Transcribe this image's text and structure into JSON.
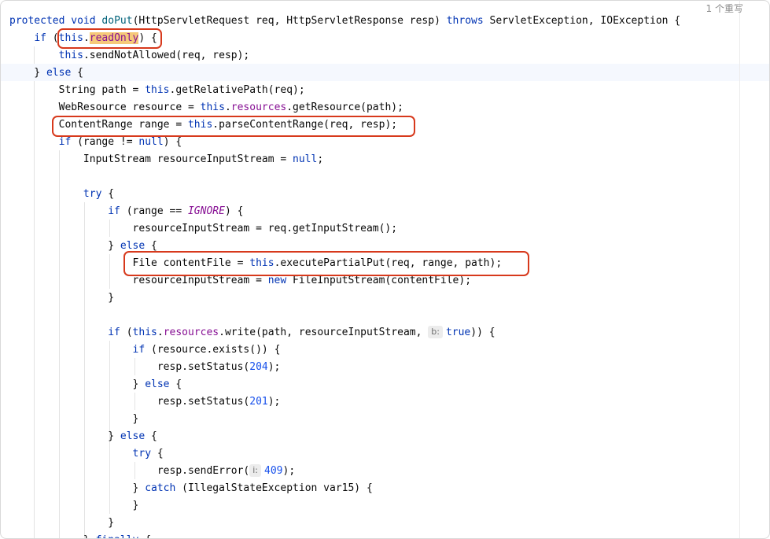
{
  "editor": {
    "inlay_hint": "1 个重写",
    "lines": [
      [
        [
          "kw",
          "protected"
        ],
        [
          "plain",
          " "
        ],
        [
          "kw",
          "void"
        ],
        [
          "plain",
          " "
        ],
        [
          "fn",
          "doPut"
        ],
        [
          "plain",
          "(HttpServletRequest req, HttpServletResponse resp) "
        ],
        [
          "kw",
          "throws"
        ],
        [
          "plain",
          " ServletException, IOException {"
        ]
      ],
      [
        [
          "plain",
          "    "
        ],
        [
          "kw",
          "if"
        ],
        [
          "plain",
          " ("
        ],
        [
          "kw",
          "this"
        ],
        [
          "plain",
          "."
        ],
        [
          "fld",
          "readOnly"
        ],
        [
          "plain",
          ") {"
        ]
      ],
      [
        [
          "plain",
          "        "
        ],
        [
          "kw",
          "this"
        ],
        [
          "plain",
          ".sendNotAllowed(req, resp);"
        ]
      ],
      [
        [
          "plain",
          "    } "
        ],
        [
          "kw",
          "else"
        ],
        [
          "plain",
          " {"
        ]
      ],
      [
        [
          "plain",
          "        String path = "
        ],
        [
          "kw",
          "this"
        ],
        [
          "plain",
          ".getRelativePath(req);"
        ]
      ],
      [
        [
          "plain",
          "        WebResource resource = "
        ],
        [
          "kw",
          "this"
        ],
        [
          "plain",
          "."
        ],
        [
          "fld",
          "resources"
        ],
        [
          "plain",
          ".getResource(path);"
        ]
      ],
      [
        [
          "plain",
          "        ContentRange range = "
        ],
        [
          "kw",
          "this"
        ],
        [
          "plain",
          ".parseContentRange(req, resp);"
        ]
      ],
      [
        [
          "plain",
          "        "
        ],
        [
          "kw",
          "if"
        ],
        [
          "plain",
          " (range != "
        ],
        [
          "kw",
          "null"
        ],
        [
          "plain",
          ") {"
        ]
      ],
      [
        [
          "plain",
          "            InputStream resourceInputStream = "
        ],
        [
          "kw",
          "null"
        ],
        [
          "plain",
          ";"
        ]
      ],
      [
        [
          "plain",
          ""
        ]
      ],
      [
        [
          "plain",
          "            "
        ],
        [
          "kw",
          "try"
        ],
        [
          "plain",
          " {"
        ]
      ],
      [
        [
          "plain",
          "                "
        ],
        [
          "kw",
          "if"
        ],
        [
          "plain",
          " (range == "
        ],
        [
          "cst",
          "IGNORE"
        ],
        [
          "plain",
          ") {"
        ]
      ],
      [
        [
          "plain",
          "                    resourceInputStream = req.getInputStream();"
        ]
      ],
      [
        [
          "plain",
          "                } "
        ],
        [
          "kw",
          "else"
        ],
        [
          "plain",
          " {"
        ]
      ],
      [
        [
          "plain",
          "                    File contentFile = "
        ],
        [
          "kw",
          "this"
        ],
        [
          "plain",
          ".executePartialPut(req, range, path);"
        ]
      ],
      [
        [
          "plain",
          "                    resourceInputStream = "
        ],
        [
          "kw",
          "new"
        ],
        [
          "plain",
          " FileInputStream(contentFile);"
        ]
      ],
      [
        [
          "plain",
          "                }"
        ]
      ],
      [
        [
          "plain",
          ""
        ]
      ],
      [
        [
          "plain",
          "                "
        ],
        [
          "kw",
          "if"
        ],
        [
          "plain",
          " ("
        ],
        [
          "kw",
          "this"
        ],
        [
          "plain",
          "."
        ],
        [
          "fld",
          "resources"
        ],
        [
          "plain",
          ".write(path, resourceInputStream, "
        ],
        [
          "hint",
          "b:"
        ],
        [
          "kw",
          "true"
        ],
        [
          "plain",
          ")) {"
        ]
      ],
      [
        [
          "plain",
          "                    "
        ],
        [
          "kw",
          "if"
        ],
        [
          "plain",
          " (resource.exists()) {"
        ]
      ],
      [
        [
          "plain",
          "                        resp.setStatus("
        ],
        [
          "num",
          "204"
        ],
        [
          "plain",
          ");"
        ]
      ],
      [
        [
          "plain",
          "                    } "
        ],
        [
          "kw",
          "else"
        ],
        [
          "plain",
          " {"
        ]
      ],
      [
        [
          "plain",
          "                        resp.setStatus("
        ],
        [
          "num",
          "201"
        ],
        [
          "plain",
          ");"
        ]
      ],
      [
        [
          "plain",
          "                    }"
        ]
      ],
      [
        [
          "plain",
          "                } "
        ],
        [
          "kw",
          "else"
        ],
        [
          "plain",
          " {"
        ]
      ],
      [
        [
          "plain",
          "                    "
        ],
        [
          "kw",
          "try"
        ],
        [
          "plain",
          " {"
        ]
      ],
      [
        [
          "plain",
          "                        resp.sendError("
        ],
        [
          "hint",
          "i:"
        ],
        [
          "num",
          "409"
        ],
        [
          "plain",
          ");"
        ]
      ],
      [
        [
          "plain",
          "                    } "
        ],
        [
          "kw",
          "catch"
        ],
        [
          "plain",
          " (IllegalStateException var15) {"
        ]
      ],
      [
        [
          "plain",
          "                    }"
        ]
      ],
      [
        [
          "plain",
          "                }"
        ]
      ],
      [
        [
          "plain",
          "            } "
        ],
        [
          "kw",
          "finally"
        ],
        [
          "plain",
          " {"
        ]
      ]
    ]
  }
}
